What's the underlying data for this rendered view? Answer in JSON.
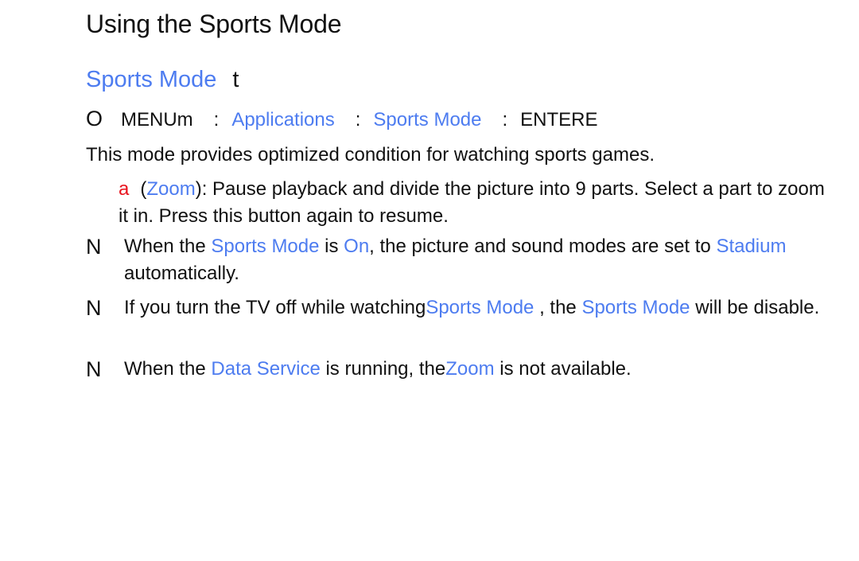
{
  "page": {
    "title": "Using the Sports Mode",
    "subtitle": {
      "label": "Sports Mode",
      "suffix": "t"
    },
    "menu_path": {
      "prefix_icon": "O",
      "menu": "MENUm",
      "separator": ":",
      "step1": "Applications",
      "step2": "Sports Mode",
      "enter": "ENTERE"
    },
    "description": "This mode provides optimized condition for watching sports games.",
    "zoom_item": {
      "button_glyph": "a",
      "open_paren": "(",
      "label": "Zoom",
      "text": "): Pause playback and divide the picture into 9 parts. Select a part to zoom it in. Press this button again to resume."
    },
    "notes": [
      {
        "marker": "N",
        "parts": [
          "When the ",
          "Sports Mode",
          " is ",
          "On",
          ", the picture and sound modes are set to ",
          "Stadium",
          " automatically."
        ]
      },
      {
        "marker": "N",
        "parts": [
          "If you turn the TV off while watching",
          "Sports Mode",
          " , the ",
          "Sports Mode",
          "  will be disable."
        ]
      },
      {
        "marker": "N",
        "parts": [
          "When the ",
          "Data Service",
          "  is running, the",
          "Zoom",
          "  is not available."
        ]
      }
    ],
    "colors": {
      "accent_blue": "#4d7cf0",
      "button_red": "#e8141e",
      "text": "#111111"
    }
  }
}
